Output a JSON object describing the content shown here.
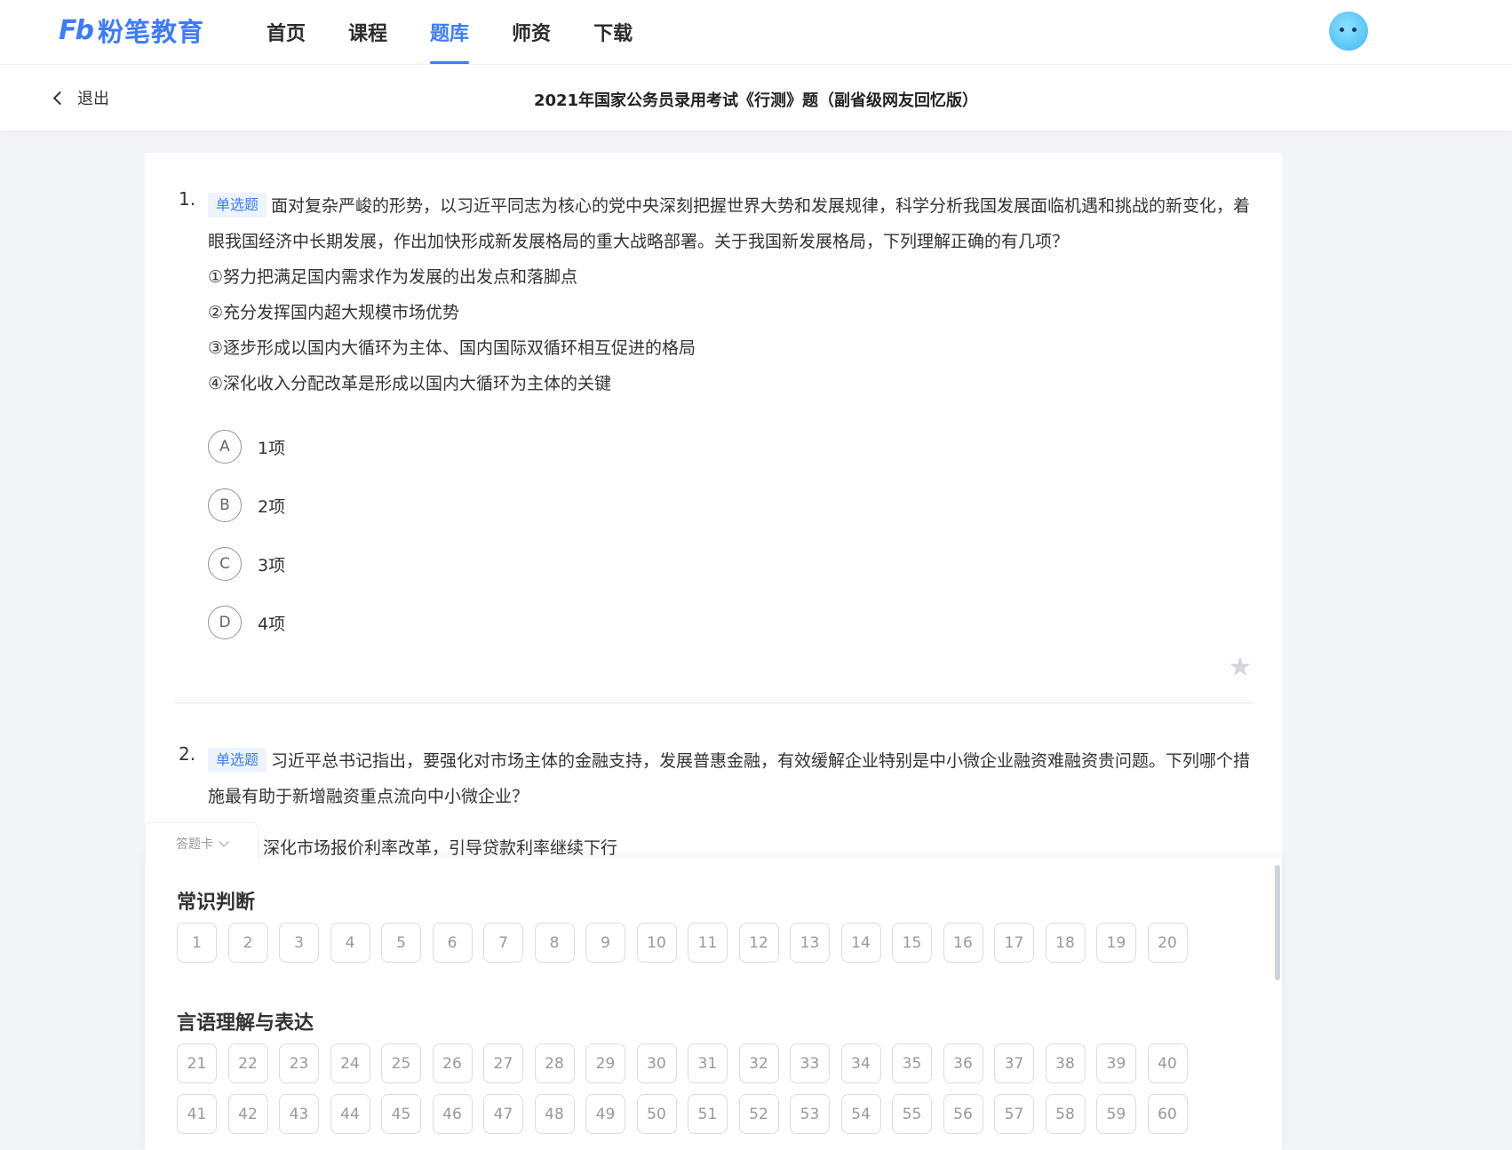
{
  "nav": {
    "logo_mark": "Fb",
    "logo_text": "粉笔教育",
    "items": [
      {
        "label": "首页"
      },
      {
        "label": "课程"
      },
      {
        "label": "题库"
      },
      {
        "label": "师资"
      },
      {
        "label": "下载"
      }
    ],
    "active_index": 2,
    "accent_color": "#3c7cfc"
  },
  "subheader": {
    "back_label": "退出",
    "paper_title": "2021年国家公务员录用考试《行测》题（副省级网友回忆版）"
  },
  "questions": [
    {
      "number": "1.",
      "type_tag": "单选题",
      "stem": "面对复杂严峻的形势，以习近平同志为核心的党中央深刻把握世界大势和发展规律，科学分析我国发展面临机遇和挑战的新变化，着眼我国经济中长期发展，作出加快形成新发展格局的重大战略部署。关于我国新发展格局，下列理解正确的有几项？",
      "statements": [
        "①努力把满足国内需求作为发展的出发点和落脚点",
        "②充分发挥国内超大规模市场优势",
        "③逐步形成以国内大循环为主体、国内国际双循环相互促进的格局",
        "④深化收入分配改革是形成以国内大循环为主体的关键"
      ],
      "options": [
        {
          "letter": "A",
          "text": "1项"
        },
        {
          "letter": "B",
          "text": "2项"
        },
        {
          "letter": "C",
          "text": "3项"
        },
        {
          "letter": "D",
          "text": "4项"
        }
      ]
    },
    {
      "number": "2.",
      "type_tag": "单选题",
      "stem": "习近平总书记指出，要强化对市场主体的金融支持，发展普惠金融，有效缓解企业特别是中小微企业融资难融资贵问题。下列哪个措施最有助于新增融资重点流向中小微企业？",
      "partial_option": "深化市场报价利率改革，引导贷款利率继续下行"
    }
  ],
  "answer_card": {
    "toggle_label": "答题卡",
    "sections": [
      {
        "title": "常识判断",
        "numbers": [
          "1",
          "2",
          "3",
          "4",
          "5",
          "6",
          "7",
          "8",
          "9",
          "10",
          "11",
          "12",
          "13",
          "14",
          "15",
          "16",
          "17",
          "18",
          "19",
          "20"
        ]
      },
      {
        "title": "言语理解与表达",
        "numbers": [
          "21",
          "22",
          "23",
          "24",
          "25",
          "26",
          "27",
          "28",
          "29",
          "30",
          "31",
          "32",
          "33",
          "34",
          "35",
          "36",
          "37",
          "38",
          "39",
          "40",
          "41",
          "42",
          "43",
          "44",
          "45",
          "46",
          "47",
          "48",
          "49",
          "50",
          "51",
          "52",
          "53",
          "54",
          "55",
          "56",
          "57",
          "58",
          "59",
          "60"
        ]
      }
    ]
  }
}
